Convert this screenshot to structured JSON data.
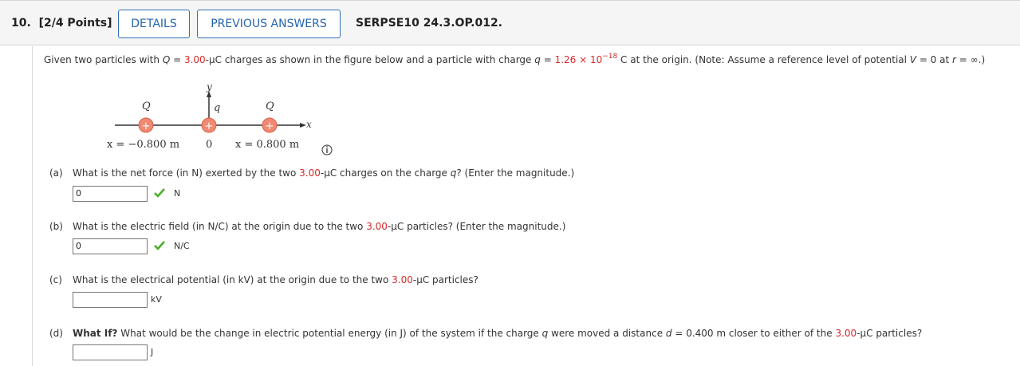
{
  "header": {
    "question_number": "10.",
    "points": "[2/4 Points]",
    "details_label": "DETAILS",
    "previous_answers_label": "PREVIOUS ANSWERS",
    "problem_code": "SERPSE10 24.3.OP.012."
  },
  "intro": {
    "t1": "Given two particles with ",
    "Q": "Q",
    "eq1": " = ",
    "q_val": "3.00",
    "t2": "-µC charges as shown in the figure below and a particle with charge ",
    "q": "q",
    "eq2": " = ",
    "charge_base": "1.26 × 10",
    "charge_exp": "−18",
    "t3": " C at the origin. (Note: Assume a reference level of potential ",
    "V": "V",
    "t4": " = 0 at ",
    "r": "r",
    "t5": " = ∞.)"
  },
  "figure": {
    "left_label": "Q",
    "center_label": "q",
    "right_label": "Q",
    "y_axis": "y",
    "x_axis": "x",
    "left_pos": "x = −0.800 m",
    "origin": "0",
    "right_pos": "x = 0.800 m",
    "charge_sign": "+"
  },
  "parts": {
    "a": {
      "label": "(a)",
      "q1": "What is the net force (in N) exerted by the two ",
      "val": "3.00",
      "q2": "-µC charges on the charge ",
      "var": "q",
      "q3": "? (Enter the magnitude.)",
      "answer": "0",
      "unit": "N"
    },
    "b": {
      "label": "(b)",
      "q1": "What is the electric field (in N/C) at the origin due to the two ",
      "val": "3.00",
      "q2": "-µC particles? (Enter the magnitude.)",
      "answer": "0",
      "unit": "N/C"
    },
    "c": {
      "label": "(c)",
      "q1": "What is the electrical potential (in kV) at the origin due to the two ",
      "val": "3.00",
      "q2": "-µC particles?",
      "answer": "",
      "unit": "kV"
    },
    "d": {
      "label": "(d)",
      "bold": "What If?",
      "q1": " What would be the change in electric potential energy (in J) of the system if the charge ",
      "var": "q",
      "q2": " were moved a distance ",
      "dvar": "d",
      "q3": " = 0.400 m closer to either of the ",
      "val": "3.00",
      "q4": "-µC particles?",
      "answer": "",
      "unit": "J"
    }
  },
  "colors": {
    "accent": "#2565ae",
    "highlight": "#d62a2a",
    "correct": "#4caf2a",
    "charge": "#f08a73"
  }
}
